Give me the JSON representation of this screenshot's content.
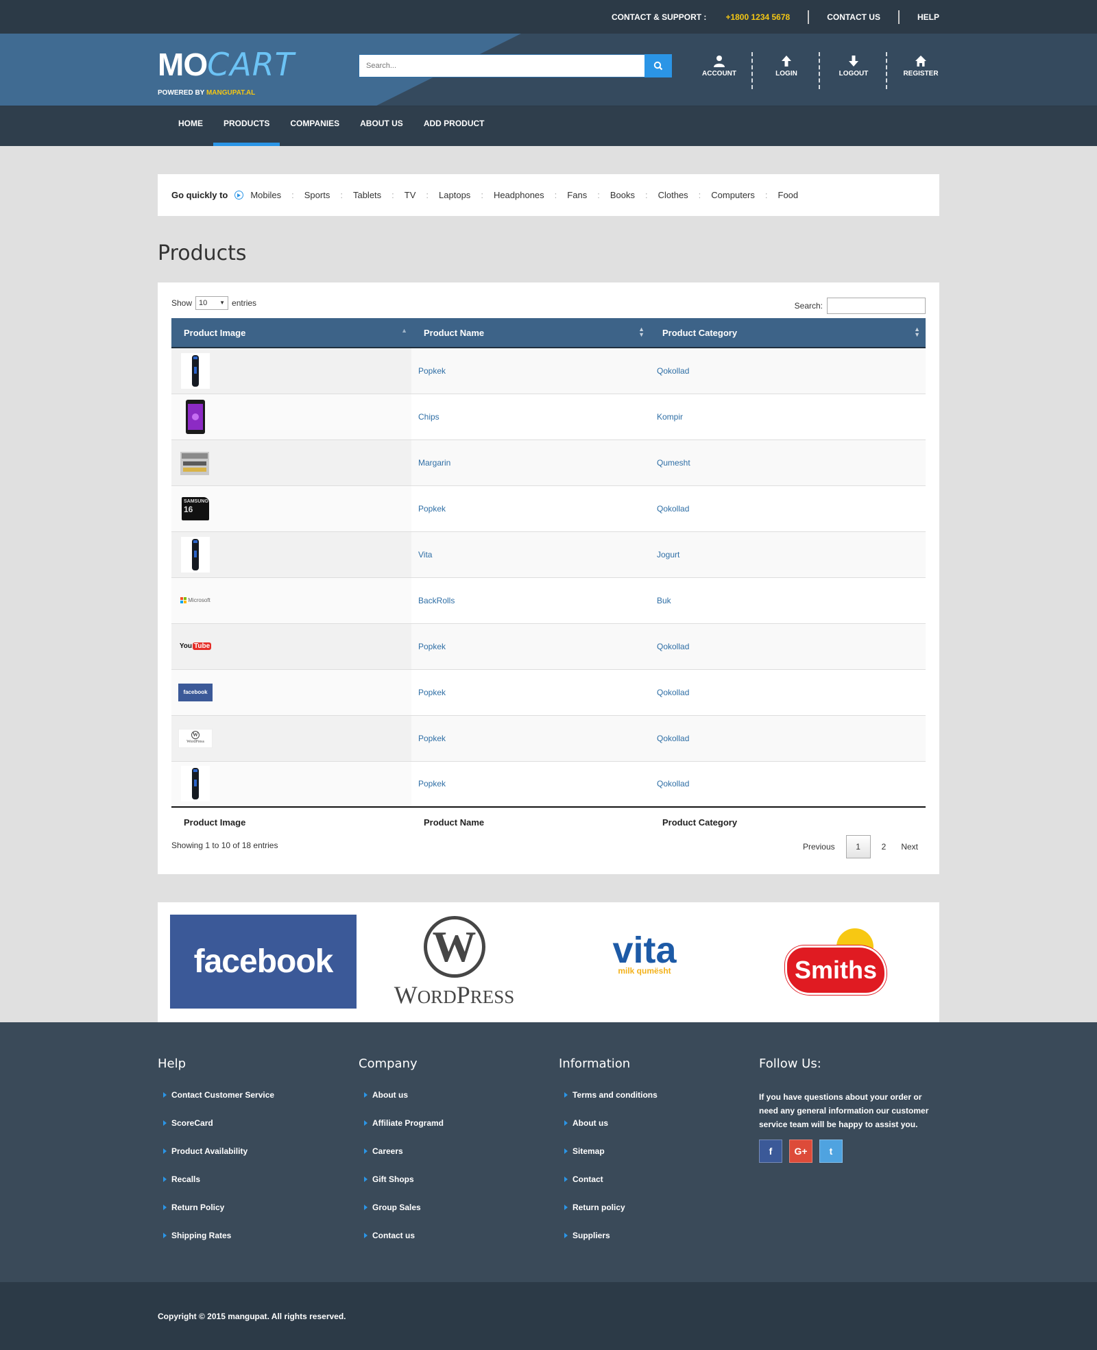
{
  "topbar": {
    "contact_label": "CONTACT & SUPPORT :",
    "phone": "+1800 1234 5678",
    "contact_us": "CONTACT US",
    "help": "HELP"
  },
  "header": {
    "logo_mo": "MO",
    "logo_cart": "CART",
    "powered_prefix": "POWERED BY",
    "powered_brand": "MANGUPAT.AL",
    "search_placeholder": "Search...",
    "icons": [
      {
        "label": "ACCOUNT",
        "icon": "user-icon"
      },
      {
        "label": "LOGIN",
        "icon": "arrow-up-icon"
      },
      {
        "label": "LOGOUT",
        "icon": "arrow-down-icon"
      },
      {
        "label": "REGISTER",
        "icon": "home-icon"
      }
    ]
  },
  "nav": [
    "HOME",
    "PRODUCTS",
    "COMPANIES",
    "ABOUT US",
    "ADD PRODUCT"
  ],
  "nav_active": "PRODUCTS",
  "quick": {
    "title": "Go quickly to",
    "items": [
      "Mobiles",
      "Sports",
      "Tablets",
      "TV",
      "Laptops",
      "Headphones",
      "Fans",
      "Books",
      "Clothes",
      "Computers",
      "Food"
    ]
  },
  "page_title": "Products",
  "table": {
    "show_label": "Show",
    "entries_value": "10",
    "entries_label": "entries",
    "search_label": "Search:",
    "columns": [
      "Product Image",
      "Product Name",
      "Product Category"
    ],
    "rows": [
      {
        "image": "trimmer",
        "name": "Popkek",
        "category": "Qokollad"
      },
      {
        "image": "phone",
        "name": "Chips",
        "category": "Kompir"
      },
      {
        "image": "toolkit",
        "name": "Margarin",
        "category": "Qumesht"
      },
      {
        "image": "sdcard",
        "name": "Popkek",
        "category": "Qokollad"
      },
      {
        "image": "trimmer",
        "name": "Vita",
        "category": "Jogurt"
      },
      {
        "image": "microsoft",
        "name": "BackRolls",
        "category": "Buk"
      },
      {
        "image": "youtube",
        "name": "Popkek",
        "category": "Qokollad"
      },
      {
        "image": "facebook",
        "name": "Popkek",
        "category": "Qokollad"
      },
      {
        "image": "wordpress",
        "name": "Popkek",
        "category": "Qokollad"
      },
      {
        "image": "trimmer",
        "name": "Popkek",
        "category": "Qokollad"
      }
    ],
    "info": "Showing 1 to 10 of 18 entries",
    "pager": {
      "previous": "Previous",
      "pages": [
        "1",
        "2"
      ],
      "current": "1",
      "next": "Next"
    }
  },
  "thumb_text": {
    "sdcard_brand": "SAMSUNG",
    "sdcard_size": "16",
    "microsoft": "Microsoft",
    "youtube_you": "You",
    "youtube_tube": "Tube",
    "facebook": "facebook",
    "wordpress": "WordPress"
  },
  "brands": {
    "facebook": "facebook",
    "wordpress_big": "W",
    "wordpress_first": "W",
    "wordpress_rest": "ORD",
    "wordpress_p": "P",
    "wordpress_rest2": "RESS",
    "vita": "vita",
    "vita_sub": "milk qumësht",
    "smiths": "Smiths"
  },
  "footer": {
    "help": {
      "title": "Help",
      "items": [
        "Contact Customer Service",
        "ScoreCard",
        "Product Availability",
        "Recalls",
        "Return Policy",
        "Shipping Rates"
      ]
    },
    "company": {
      "title": "Company",
      "items": [
        "About us",
        "Affiliate Programd",
        "Careers",
        "Gift Shops",
        "Group Sales",
        "Contact us"
      ]
    },
    "information": {
      "title": "Information",
      "items": [
        "Terms and conditions",
        "About us",
        "Sitemap",
        "Contact",
        "Return policy",
        "Suppliers"
      ]
    },
    "follow": {
      "title": "Follow Us:",
      "text": "If you have questions about your order or need any general information our customer service team will be happy to assist you.",
      "social": [
        "f",
        "G+",
        "t"
      ]
    },
    "copyright_prefix": "Copyright © 2015",
    "copyright_brand": "mangupat",
    "copyright_suffix": ". All rights reserved."
  },
  "colors": {
    "accent": "#2b95e6",
    "phone": "#f3c614",
    "header": "#354a5e",
    "footer": "#3a4a59",
    "table_head": "#3d6388",
    "link": "#2e6ea5"
  }
}
